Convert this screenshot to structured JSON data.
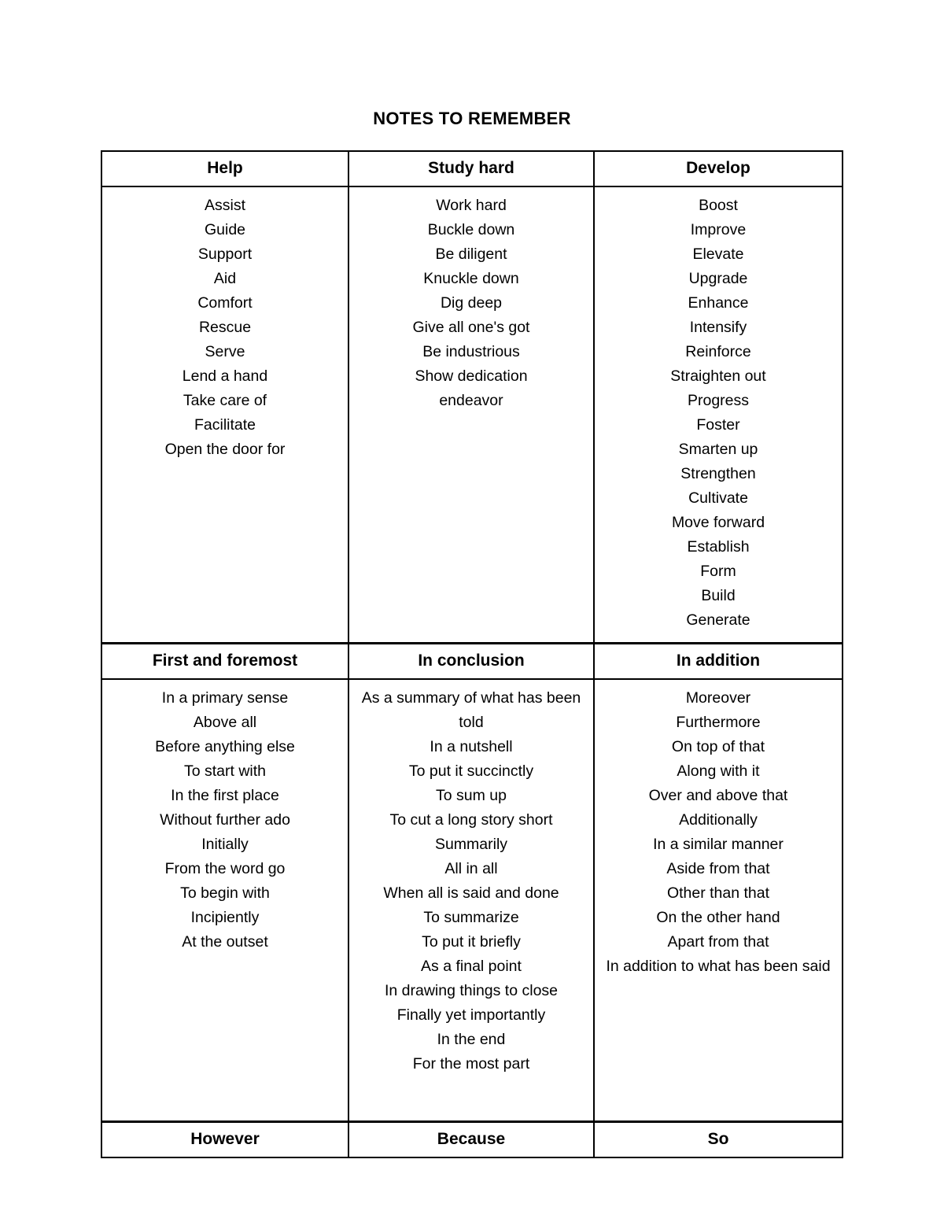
{
  "document": {
    "title": "NOTES TO REMEMBER"
  },
  "table": {
    "sections": [
      {
        "headers": [
          "Help",
          "Study hard",
          "Develop"
        ],
        "columns": [
          [
            "Assist",
            "Guide",
            "Support",
            "Aid",
            "Comfort",
            "Rescue",
            "Serve",
            "Lend a hand",
            "Take care of",
            "Facilitate",
            "Open the door for"
          ],
          [
            "Work hard",
            "Buckle down",
            "Be diligent",
            "Knuckle down",
            "Dig deep",
            "Give all one's got",
            "Be industrious",
            "Show dedication",
            "endeavor"
          ],
          [
            "Boost",
            "Improve",
            "Elevate",
            "Upgrade",
            "Enhance",
            "Intensify",
            "Reinforce",
            "Straighten out",
            "Progress",
            "Foster",
            "Smarten up",
            "Strengthen",
            "Cultivate",
            "Move forward",
            "Establish",
            "Form",
            "Build",
            "Generate"
          ]
        ]
      },
      {
        "headers": [
          "First and foremost",
          "In conclusion",
          "In addition"
        ],
        "columns": [
          [
            "In a primary sense",
            "Above all",
            "Before anything else",
            "To start with",
            "In the first place",
            "Without further ado",
            "Initially",
            "From the word go",
            "To begin with",
            "Incipiently",
            "At the outset"
          ],
          [
            "As a summary of what has been told",
            "In a nutshell",
            "To put it succinctly",
            "To sum up",
            "To cut a long story short",
            "Summarily",
            "All in all",
            "When all is said and done",
            "To summarize",
            "To put it briefly",
            "As a final point",
            "In drawing things to close",
            "Finally yet importantly",
            "In the end",
            "For the most part"
          ],
          [
            "Moreover",
            "Furthermore",
            "On top of that",
            "Along with it",
            "Over and above that",
            "Additionally",
            "In a similar manner",
            "Aside from that",
            "Other than that",
            "On the other hand",
            "Apart from that",
            "In addition to what has been said"
          ]
        ]
      }
    ],
    "footer": [
      "However",
      "Because",
      "So"
    ]
  }
}
